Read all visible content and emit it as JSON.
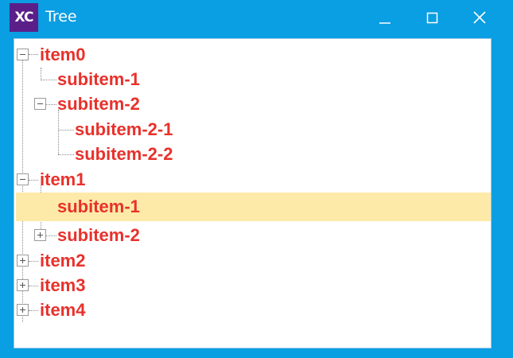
{
  "window": {
    "title": "Tree",
    "logo_text": "XC",
    "accent_color": "#0a9ee3",
    "logo_color": "#5b1f8a"
  },
  "controls": {
    "minimize_icon": "minimize-icon",
    "maximize_icon": "maximize-icon",
    "close_icon": "close-icon"
  },
  "tree": {
    "label_color": "#e8312b",
    "selected_bg": "#fdeaa8",
    "nodes": [
      {
        "label": "item0",
        "level": 0,
        "state": "expanded"
      },
      {
        "label": "subitem-1",
        "level": 1,
        "state": "leaf"
      },
      {
        "label": "subitem-2",
        "level": 1,
        "state": "expanded"
      },
      {
        "label": "subitem-2-1",
        "level": 2,
        "state": "leaf"
      },
      {
        "label": "subitem-2-2",
        "level": 2,
        "state": "leaf"
      },
      {
        "label": "item1",
        "level": 0,
        "state": "expanded"
      },
      {
        "label": "subitem-1",
        "level": 1,
        "state": "leaf",
        "selected": true
      },
      {
        "label": "subitem-2",
        "level": 1,
        "state": "collapsed"
      },
      {
        "label": "item2",
        "level": 0,
        "state": "collapsed"
      },
      {
        "label": "item3",
        "level": 0,
        "state": "collapsed"
      },
      {
        "label": "item4",
        "level": 0,
        "state": "collapsed"
      }
    ]
  }
}
